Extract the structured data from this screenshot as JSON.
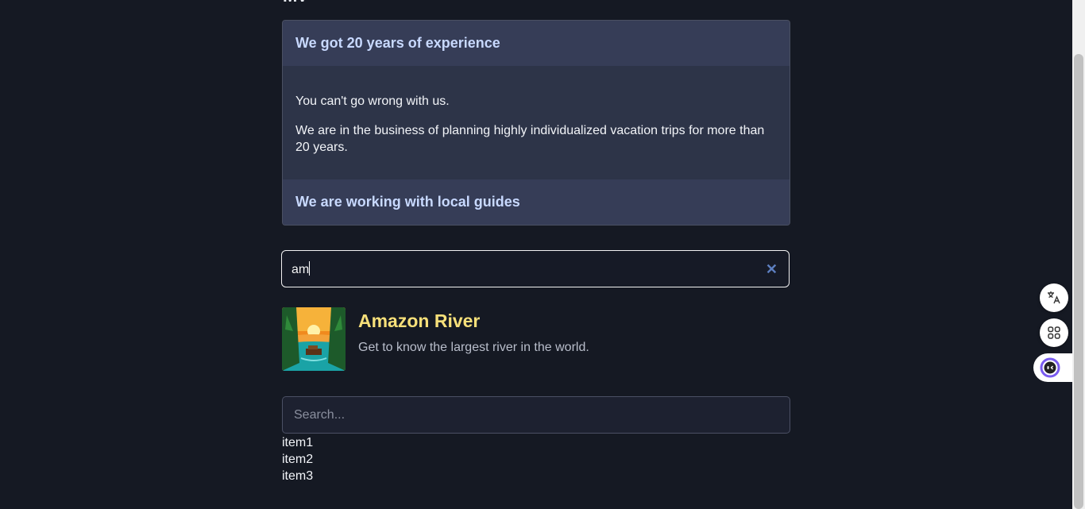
{
  "accordion": {
    "sections": [
      {
        "title": "We got 20 years of experience",
        "paragraphs": [
          "You can't go wrong with us.",
          "We are in the business of planning highly individualized vacation trips for more than 20 years."
        ]
      },
      {
        "title": "We are working with local guides"
      }
    ]
  },
  "search": {
    "value": "am",
    "clear_icon": "x-icon"
  },
  "result": {
    "title": "Amazon River",
    "description": "Get to know the largest river in the world."
  },
  "search2": {
    "placeholder": "Search..."
  },
  "list": {
    "items": [
      "item1",
      "item2",
      "item3"
    ]
  },
  "side_buttons": {
    "icons": [
      "translate-icon",
      "apps-grid-icon",
      "assistant-icon"
    ]
  }
}
